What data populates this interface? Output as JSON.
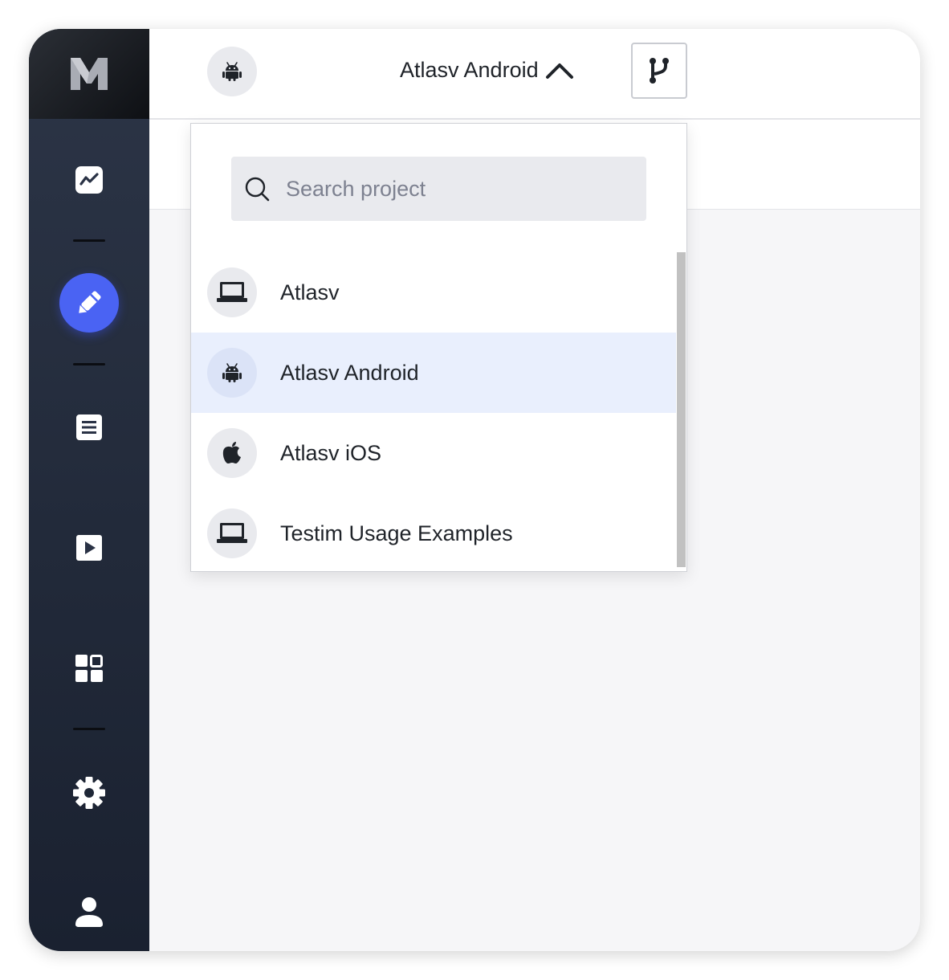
{
  "sidebar": {
    "logo_icon": "m-logo-icon",
    "items": [
      {
        "name": "analytics",
        "icon": "trend-chart-icon"
      },
      {
        "name": "editor",
        "icon": "pencil-icon",
        "active": true
      },
      {
        "name": "tests",
        "icon": "list-document-icon"
      },
      {
        "name": "runs",
        "icon": "play-icon"
      },
      {
        "name": "dashboards",
        "icon": "grid-icon"
      },
      {
        "name": "settings",
        "icon": "gear-icon"
      },
      {
        "name": "profile",
        "icon": "user-icon"
      }
    ],
    "accent_color": "#4a63f3"
  },
  "header": {
    "current_project": "Atlasv Android",
    "current_project_icon": "android-icon",
    "dropdown_state_icon": "chevron-up-icon",
    "branch_icon": "git-branch-icon"
  },
  "project_dropdown": {
    "search": {
      "placeholder": "Search project",
      "value": ""
    },
    "projects": [
      {
        "label": "Atlasv",
        "icon": "laptop-icon",
        "selected": false
      },
      {
        "label": "Atlasv Android",
        "icon": "android-icon",
        "selected": true
      },
      {
        "label": "Atlasv iOS",
        "icon": "apple-icon",
        "selected": false
      },
      {
        "label": "Testim Usage Examples",
        "icon": "laptop-icon",
        "selected": false
      }
    ]
  }
}
